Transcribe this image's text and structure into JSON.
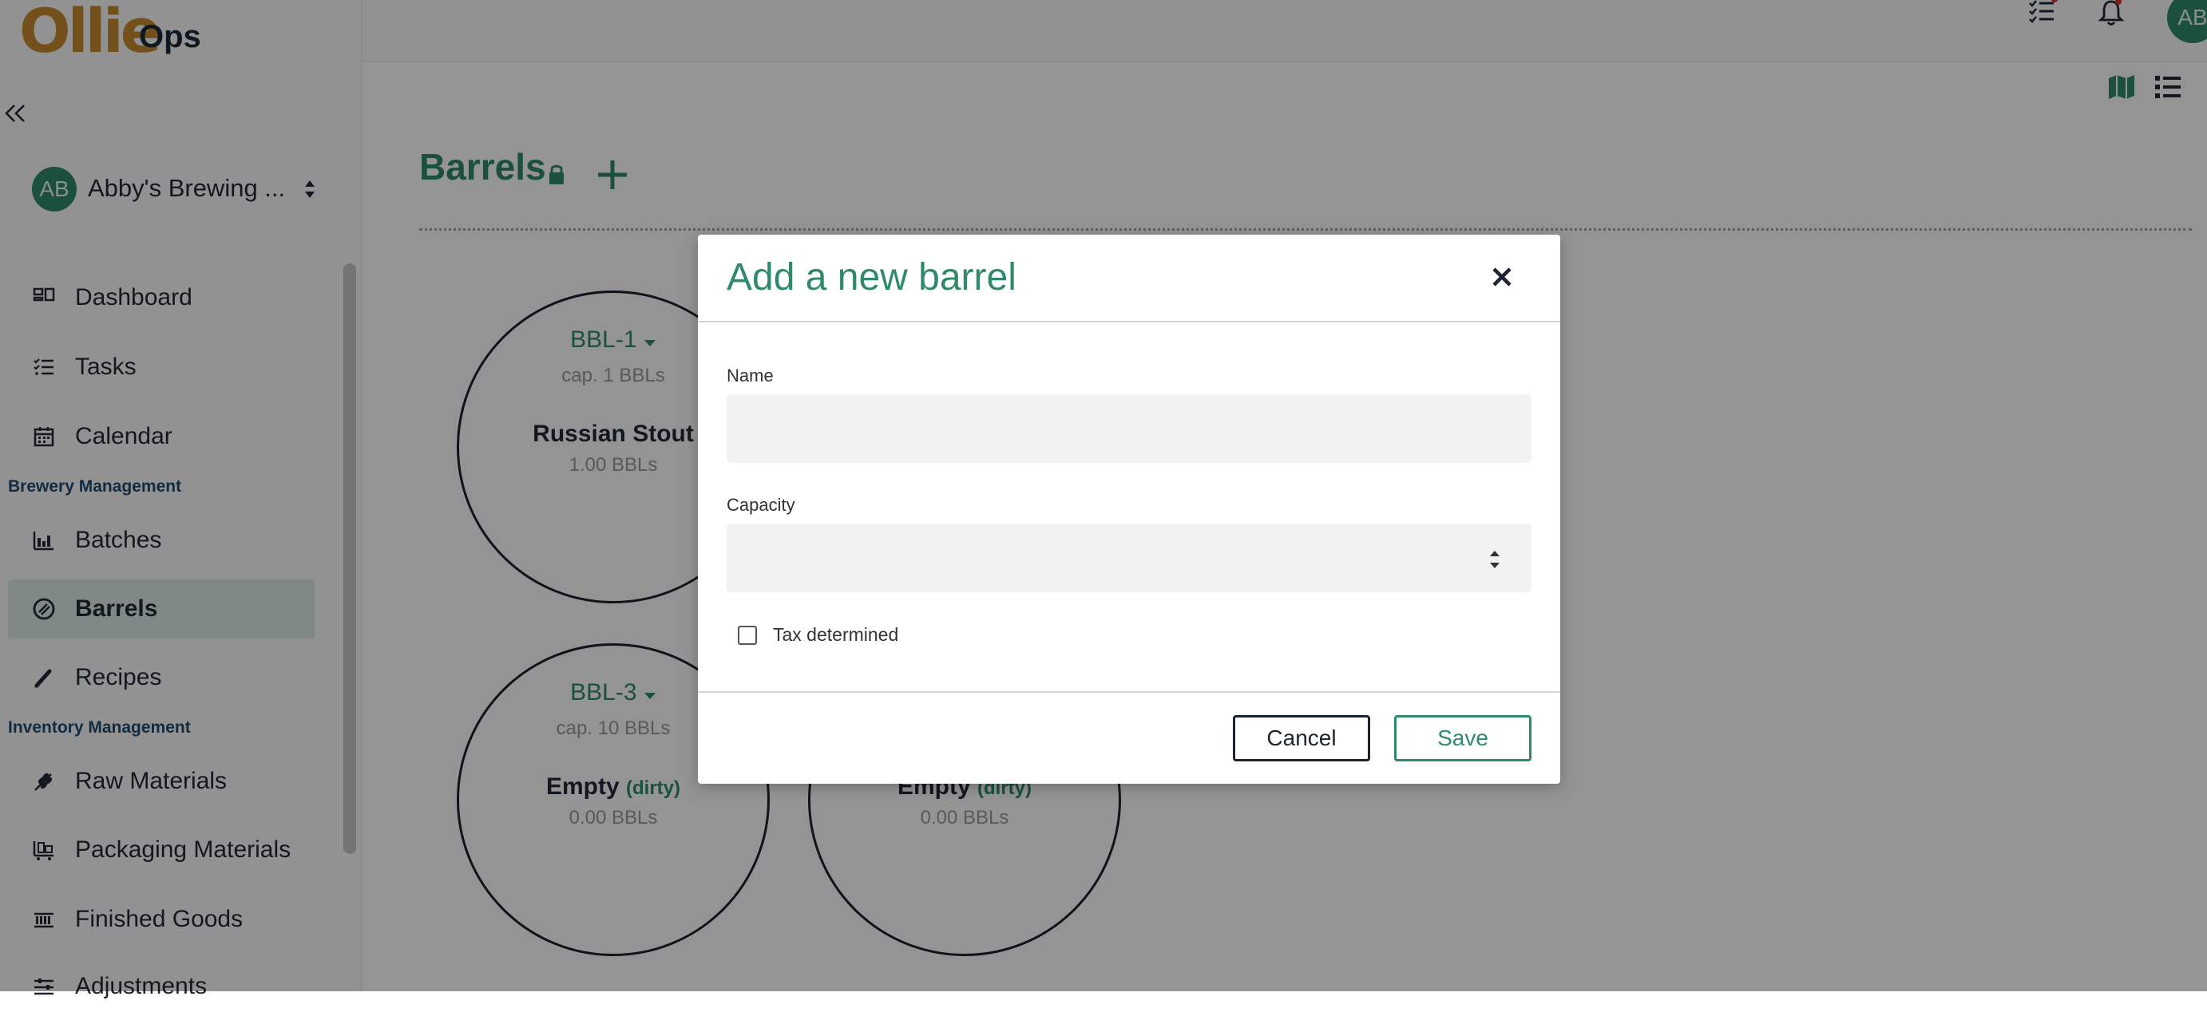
{
  "brand": {
    "logo": "Ollie",
    "product": "Ops"
  },
  "org": {
    "initials": "AB",
    "name": "Abby's Brewing ..."
  },
  "user": {
    "initials": "AB"
  },
  "nav": {
    "dashboard": "Dashboard",
    "tasks": "Tasks",
    "calendar": "Calendar",
    "section_brewery": "Brewery Management",
    "batches": "Batches",
    "barrels": "Barrels",
    "recipes": "Recipes",
    "section_inventory": "Inventory Management",
    "raw_materials": "Raw Materials",
    "packaging_materials": "Packaging Materials",
    "finished_goods": "Finished Goods",
    "adjustments": "Adjustments"
  },
  "page": {
    "title": "Barrels"
  },
  "barrels": [
    {
      "name": "BBL-1",
      "capacity": "cap. 1 BBLs",
      "content": "Russian Stout",
      "status": "",
      "volume": "1.00 BBLs"
    },
    {
      "name": "BBL-3",
      "capacity": "cap. 10 BBLs",
      "content": "Empty",
      "status": "(dirty)",
      "volume": "0.00 BBLs"
    },
    {
      "name": "",
      "capacity": "",
      "content": "Empty",
      "status": "(dirty)",
      "volume": "0.00 BBLs"
    }
  ],
  "modal": {
    "title": "Add a new barrel",
    "name_label": "Name",
    "name_value": "",
    "capacity_label": "Capacity",
    "capacity_value": "",
    "tax_label": "Tax determined",
    "tax_checked": false,
    "cancel_label": "Cancel",
    "save_label": "Save"
  },
  "colors": {
    "brand_green": "#2f8a6c",
    "logo_orange": "#c98a2e",
    "dark": "#1b2430"
  },
  "icons": [
    "collapse-icon",
    "chevron-updown-icon",
    "dashboard-icon",
    "tasks-icon",
    "calendar-icon",
    "batches-icon",
    "barrels-icon",
    "recipes-icon",
    "raw-materials-icon",
    "packaging-icon",
    "finished-goods-icon",
    "adjustments-icon",
    "checklist-icon",
    "bell-icon",
    "lock-icon",
    "add-icon",
    "map-view-icon",
    "list-view-icon",
    "caret-down-icon",
    "close-icon",
    "spinner-icon"
  ]
}
